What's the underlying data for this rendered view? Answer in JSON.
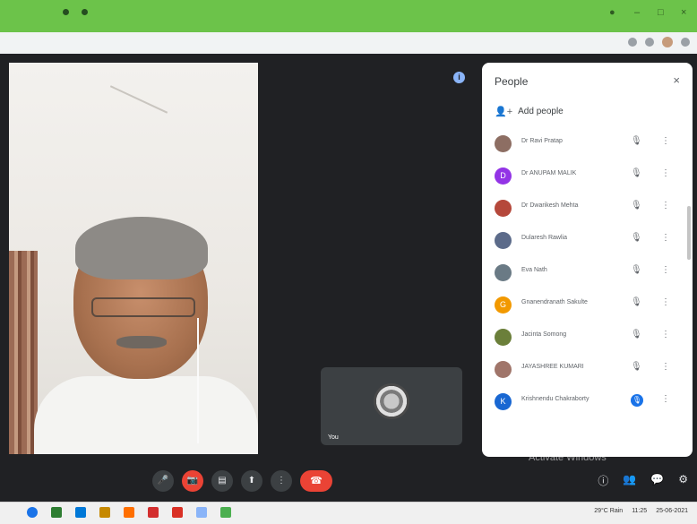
{
  "window": {
    "controls": [
      "–",
      "□",
      "×"
    ]
  },
  "meeting": {
    "self_label": "You",
    "info_icon": "i",
    "controls": [
      {
        "name": "mic",
        "glyph": "🎤"
      },
      {
        "name": "camera",
        "glyph": "📷"
      },
      {
        "name": "captions",
        "glyph": "▤"
      },
      {
        "name": "present",
        "glyph": "⬆"
      },
      {
        "name": "more",
        "glyph": "⋮"
      },
      {
        "name": "end-call",
        "glyph": "☎"
      }
    ],
    "right_controls": [
      "ⓘ",
      "👥",
      "💬",
      "⚙"
    ],
    "watermark": "Activate Windows"
  },
  "people_panel": {
    "title": "People",
    "close": "×",
    "add_people": "Add people",
    "participants": [
      {
        "name": "Dr Ravi Pratap",
        "initial": "",
        "color": "#8d6e63",
        "mic": "🎙",
        "more": "⋮"
      },
      {
        "name": "Dr ANUPAM MALIK",
        "initial": "D",
        "color": "#9334e6",
        "mic": "🎙",
        "more": "⋮"
      },
      {
        "name": "Dr Dwarikesh Mehta",
        "initial": "",
        "color": "#b5483b",
        "mic": "🎙",
        "more": "⋮"
      },
      {
        "name": "Dularesh Rawlia",
        "initial": "",
        "color": "#5c6b8a",
        "mic": "🎙",
        "more": "⋮"
      },
      {
        "name": "Eva Nath",
        "initial": "",
        "color": "#6a7a85",
        "mic": "🎙",
        "more": "⋮"
      },
      {
        "name": "Gnanendranath Sakulte",
        "initial": "G",
        "color": "#f29900",
        "mic": "🎙",
        "more": "⋮"
      },
      {
        "name": "Jacinta Somong",
        "initial": "",
        "color": "#6b7f3a",
        "mic": "🎙",
        "more": "⋮"
      },
      {
        "name": "JAYASHREE KUMARI",
        "initial": "",
        "color": "#a0756a",
        "mic": "🎙",
        "more": "⋮"
      },
      {
        "name": "Krishnendu Chakraborty",
        "initial": "K",
        "color": "#1967d2",
        "mic": "🎙",
        "more": "⋮",
        "active": true
      }
    ]
  },
  "taskbar": {
    "icons": [
      "#1a73e8",
      "#2e7d32",
      "#0078d7",
      "#c68900",
      "#ff6f00",
      "#d32f2f",
      "#d93025",
      "#8ab4f8",
      "#4caf50"
    ],
    "weather": "29°C Rain",
    "time": "11:25",
    "date": "25-06-2021"
  },
  "colors": {
    "titlebar": "#6cc34a",
    "meet_bg": "#202124",
    "end_call": "#ea4335"
  }
}
